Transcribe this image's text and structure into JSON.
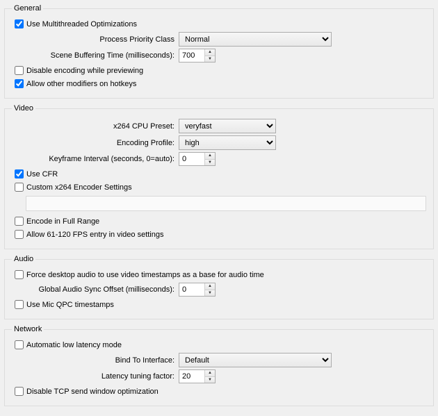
{
  "general": {
    "legend": "General",
    "multithreaded_label": "Use Multithreaded Optimizations",
    "multithreaded_checked": true,
    "priority_label": "Process Priority Class",
    "priority_value": "Normal",
    "buffering_label": "Scene Buffering Time (milliseconds):",
    "buffering_value": "700",
    "disable_preview_label": "Disable encoding while previewing",
    "disable_preview_checked": false,
    "allow_modifiers_label": "Allow other modifiers on hotkeys",
    "allow_modifiers_checked": true
  },
  "video": {
    "legend": "Video",
    "preset_label": "x264 CPU Preset:",
    "preset_value": "veryfast",
    "profile_label": "Encoding Profile:",
    "profile_value": "high",
    "keyframe_label": "Keyframe Interval (seconds, 0=auto):",
    "keyframe_value": "0",
    "use_cfr_label": "Use CFR",
    "use_cfr_checked": true,
    "custom_x264_label": "Custom x264 Encoder Settings",
    "custom_x264_checked": false,
    "full_range_label": "Encode in Full Range",
    "full_range_checked": false,
    "allow_120fps_label": "Allow 61-120 FPS entry in video settings",
    "allow_120fps_checked": false
  },
  "audio": {
    "legend": "Audio",
    "force_ts_label": "Force desktop audio to use video timestamps as a base for audio time",
    "force_ts_checked": false,
    "sync_label": "Global Audio Sync Offset (milliseconds):",
    "sync_value": "0",
    "mic_qpc_label": "Use Mic QPC timestamps",
    "mic_qpc_checked": false
  },
  "network": {
    "legend": "Network",
    "auto_lowlat_label": "Automatic low latency mode",
    "auto_lowlat_checked": false,
    "bind_label": "Bind To Interface:",
    "bind_value": "Default",
    "latency_label": "Latency tuning factor:",
    "latency_value": "20",
    "disable_tcp_label": "Disable TCP send window optimization",
    "disable_tcp_checked": false
  }
}
